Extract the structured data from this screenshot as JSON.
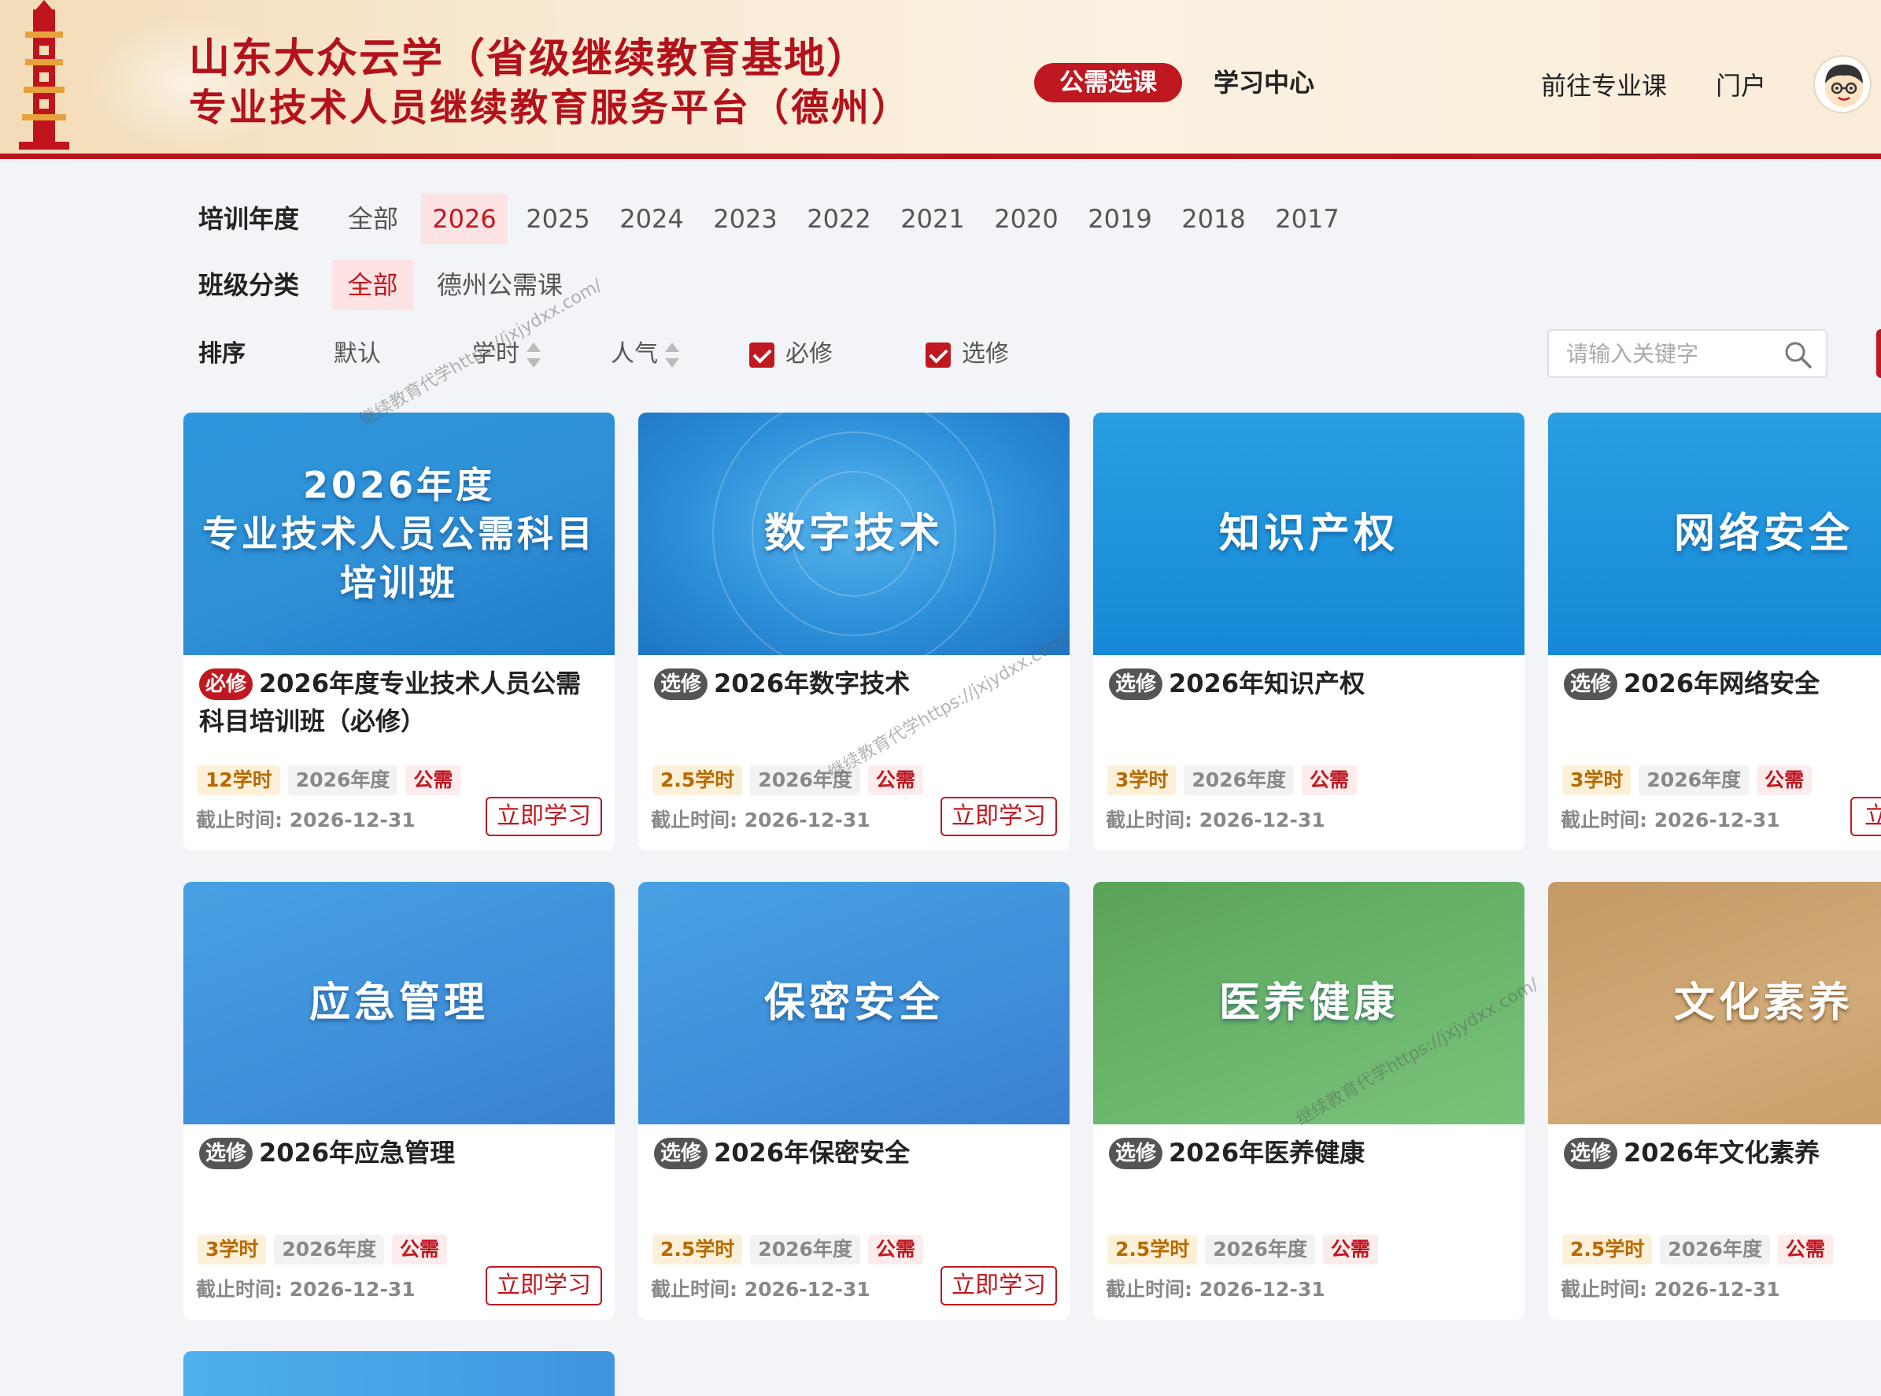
{
  "header": {
    "title_line1": "山东大众云学（省级继续教育基地）",
    "title_line2": "专业技术人员继续教育服务平台（德州）",
    "nav": {
      "active": "公需选课",
      "study_center": "学习中心",
      "pro_courses": "前往专业课",
      "portal": "门户"
    }
  },
  "filters": {
    "year_label": "培训年度",
    "years": [
      "全部",
      "2026",
      "2025",
      "2024",
      "2023",
      "2022",
      "2021",
      "2020",
      "2019",
      "2018",
      "2017"
    ],
    "selected_year": "2026",
    "class_label": "班级分类",
    "classes": [
      "全部",
      "德州公需课"
    ],
    "selected_class": "全部",
    "sort_label": "排序",
    "sort_options": [
      "默认",
      "学时",
      "人气"
    ],
    "checkboxes": [
      {
        "label": "必修",
        "checked": true
      },
      {
        "label": "选修",
        "checked": true
      }
    ],
    "search_placeholder": "请输入关键字"
  },
  "watermark": "继续教育代学https://jxjydxx.com/",
  "cards": [
    {
      "cover_title": "2026年度\n专业技术人员公需科目\n培训班",
      "badge": "必修",
      "title": "2026年度专业技术人员公需科目培训班（必修）",
      "hours": "12学时",
      "year": "2026年度",
      "type": "公需",
      "deadline": "截止时间: 2026-12-31",
      "button": "立即学习"
    },
    {
      "cover_title": "数字技术",
      "badge": "选修",
      "title": "2026年数字技术",
      "hours": "2.5学时",
      "year": "2026年度",
      "type": "公需",
      "deadline": "截止时间: 2026-12-31",
      "button": "立即学习"
    },
    {
      "cover_title": "知识产权",
      "badge": "选修",
      "title": "2026年知识产权",
      "hours": "3学时",
      "year": "2026年度",
      "type": "公需",
      "deadline": "截止时间: 2026-12-31",
      "button": ""
    },
    {
      "cover_title": "网络安全",
      "badge": "选修",
      "title": "2026年网络安全",
      "hours": "3学时",
      "year": "2026年度",
      "type": "公需",
      "deadline": "截止时间: 2026-12-31",
      "button": "立"
    },
    {
      "cover_title": "应急管理",
      "badge": "选修",
      "title": "2026年应急管理",
      "hours": "3学时",
      "year": "2026年度",
      "type": "公需",
      "deadline": "截止时间: 2026-12-31",
      "button": "立即学习"
    },
    {
      "cover_title": "保密安全",
      "badge": "选修",
      "title": "2026年保密安全",
      "hours": "2.5学时",
      "year": "2026年度",
      "type": "公需",
      "deadline": "截止时间: 2026-12-31",
      "button": "立即学习"
    },
    {
      "cover_title": "医养健康",
      "badge": "选修",
      "title": "2026年医养健康",
      "hours": "2.5学时",
      "year": "2026年度",
      "type": "公需",
      "deadline": "截止时间: 2026-12-31",
      "button": ""
    },
    {
      "cover_title": "文化素养",
      "badge": "选修",
      "title": "2026年文化素养",
      "hours": "2.5学时",
      "year": "2026年度",
      "type": "公需",
      "deadline": "截止时间: 2026-12-31",
      "button": ""
    }
  ],
  "colors": {
    "brand_red": "#c01820",
    "header_bg": "#f8ead3",
    "page_bg": "#f2f4f7"
  }
}
